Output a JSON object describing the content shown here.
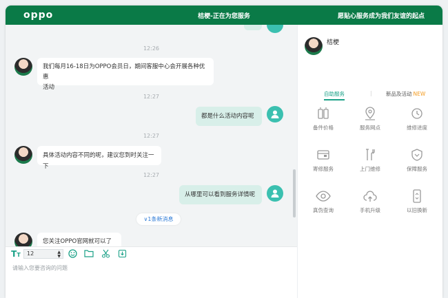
{
  "header": {
    "logo": "oppo",
    "title": "桔梗-正在为您服务",
    "slogan": "愿贴心服务成为我们友谊的起点"
  },
  "chat": {
    "times": [
      "12:26",
      "12:27",
      "12:27",
      "12:27"
    ],
    "messages": [
      {
        "from": "agent",
        "text_line1": "我们每月16-18日为OPPO会员日，期间客服中心会开展各种优惠",
        "text_line2": "活动"
      },
      {
        "from": "user",
        "text": "都是什么活动内容呢"
      },
      {
        "from": "agent",
        "text": "具体活动内容不同的呢，建议您到时关注一下"
      },
      {
        "from": "user",
        "text": "从哪里可以看到服务详情呢"
      },
      {
        "from": "agent",
        "text": "您关注OPPO官网就可以了呢"
      }
    ],
    "new_message_label": "1条新消息"
  },
  "toolbar": {
    "font_size_value": "12",
    "input_placeholder": "请输入您要咨询的问题"
  },
  "sidebar": {
    "agent_name": "桔梗",
    "tab_self_service": "自助服务",
    "tab_news": "新品及活动",
    "new_badge": "NEW",
    "items": [
      {
        "label": "备件价格",
        "icon": "battery-icon"
      },
      {
        "label": "服务网点",
        "icon": "location-icon"
      },
      {
        "label": "维修进度",
        "icon": "progress-icon"
      },
      {
        "label": "寄修服务",
        "icon": "mail-icon"
      },
      {
        "label": "上门维修",
        "icon": "tools-icon"
      },
      {
        "label": "保障服务",
        "icon": "shield-icon"
      },
      {
        "label": "真伪查询",
        "icon": "eye-icon"
      },
      {
        "label": "手机升级",
        "icon": "cloud-upload-icon"
      },
      {
        "label": "以旧换新",
        "icon": "phone-swap-icon"
      }
    ]
  },
  "colors": {
    "brand": "#0a7a47",
    "accent": "#1aa187",
    "user_bubble": "#d8efe9",
    "new_badge": "#f39a1e",
    "link": "#2e7bd6"
  }
}
